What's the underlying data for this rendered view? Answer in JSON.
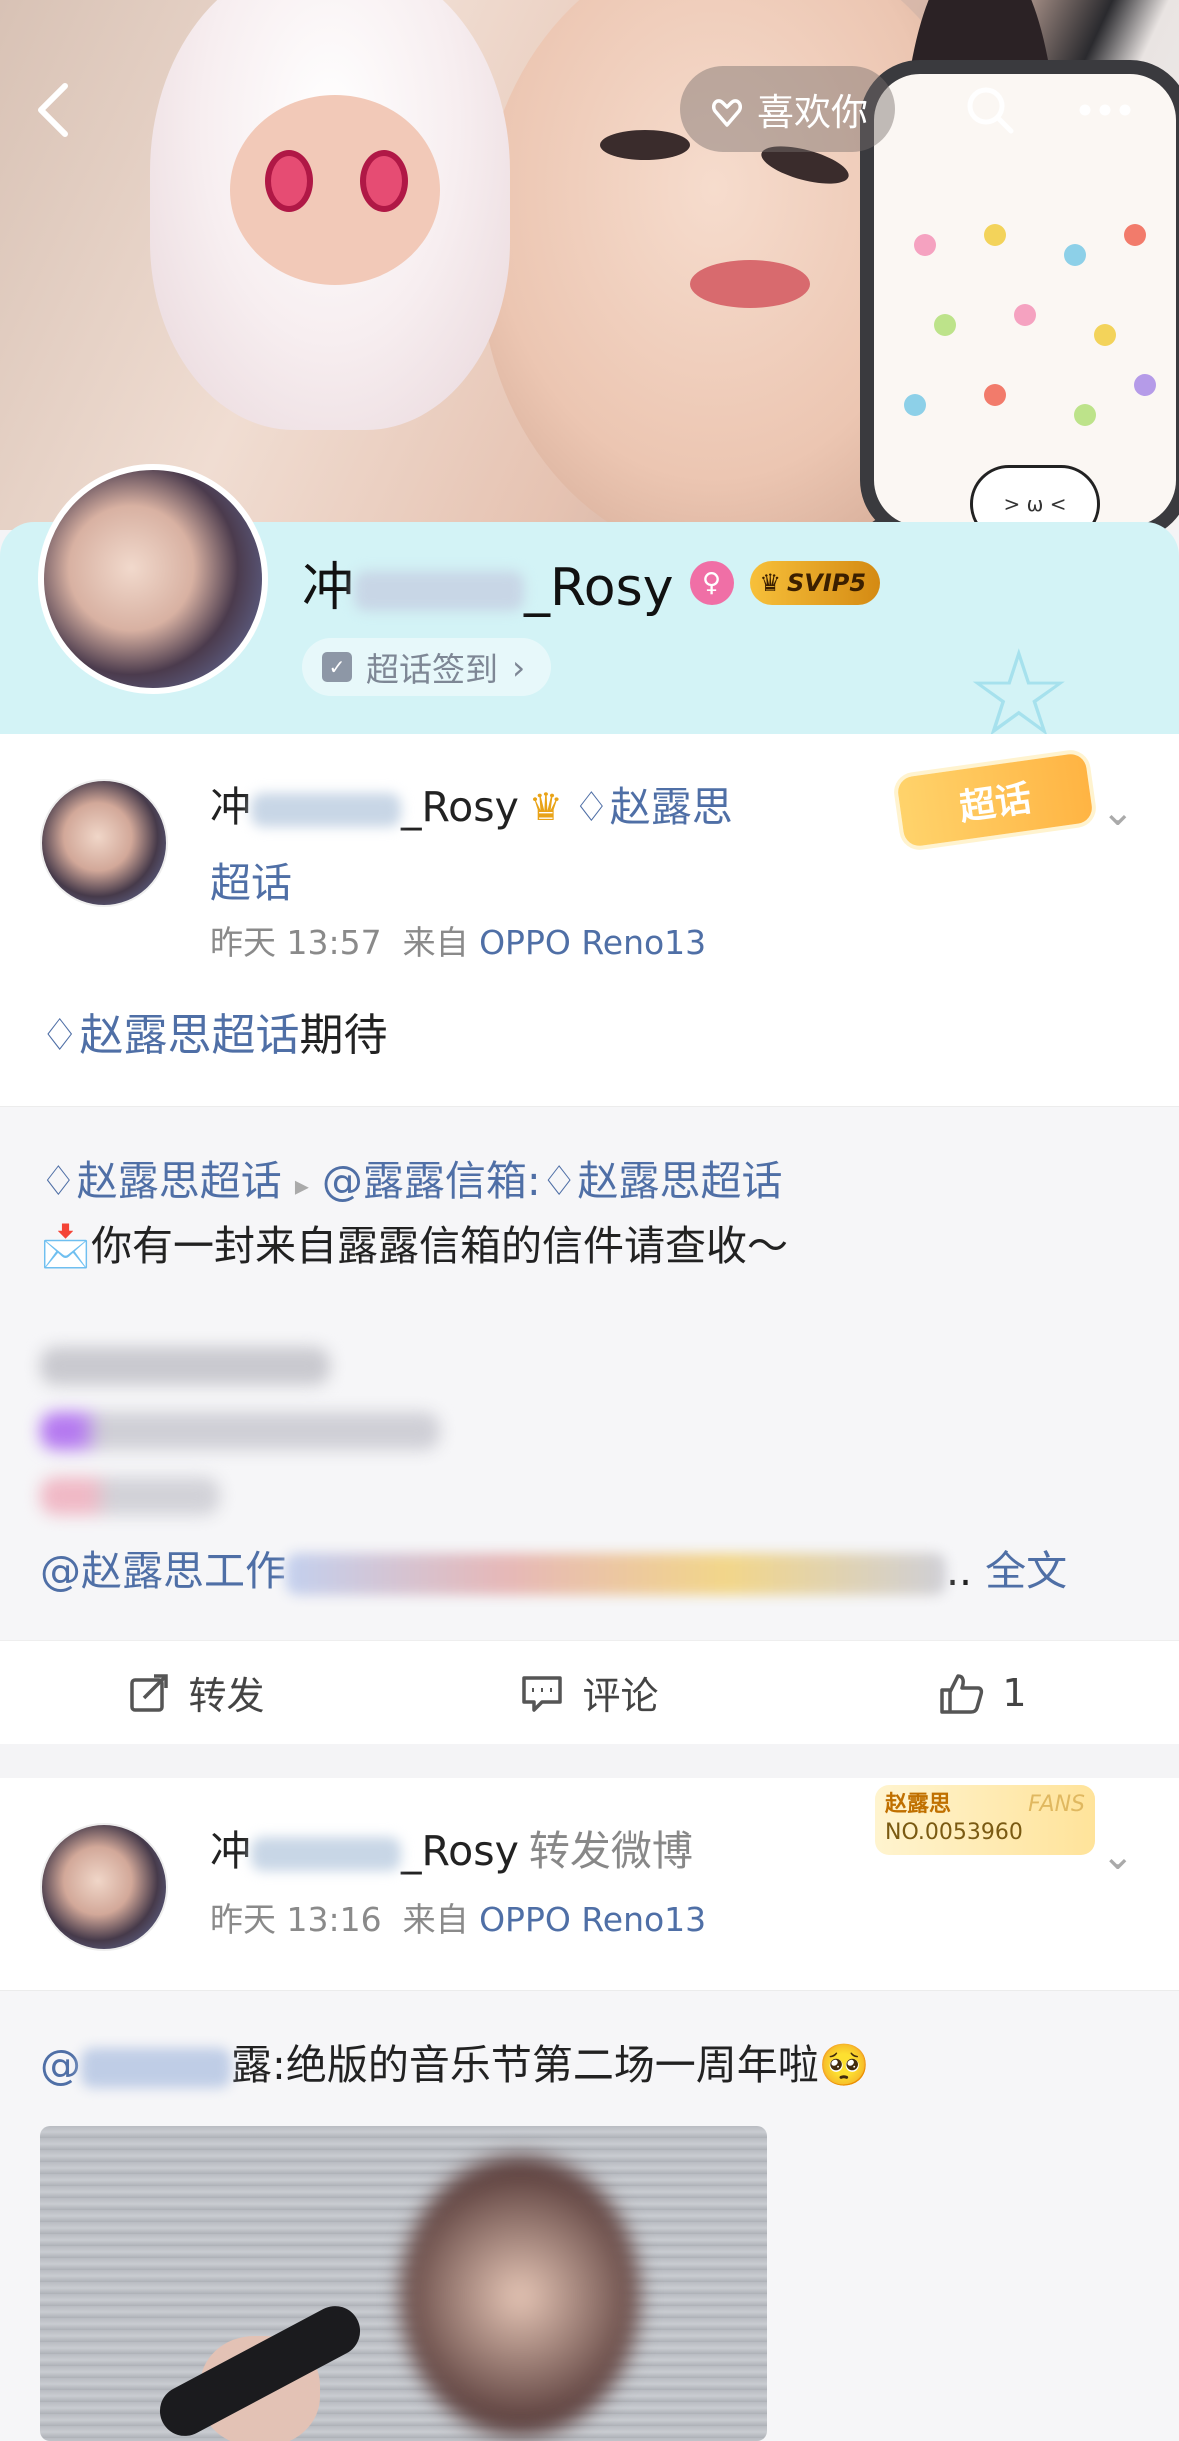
{
  "cover": {
    "back_icon": "chevron-left-icon",
    "like_label": "喜欢你",
    "like_icon": "hand-heart-icon",
    "search_icon": "search-icon",
    "more_icon": "more-dots-icon",
    "sticker_text": "> ω <"
  },
  "profile": {
    "name_prefix": "冲",
    "name_suffix": "_Rosy",
    "gender_icon": "female-icon",
    "svip_label": "SVIP5",
    "checkin_label": "超话签到",
    "checkin_arrow": "›",
    "band_color": "#d3f3f6"
  },
  "post1": {
    "author_prefix": "冲",
    "author_suffix": "_Rosy",
    "supertopic_inline": "赵露思",
    "supertopic_line2": "超话",
    "time": "昨天 13:57",
    "source_prefix": "来自",
    "device": "OPPO Reno13",
    "badge": "超话",
    "body_link": "赵露思超话",
    "body_text": "期待",
    "quote": {
      "line1_link1": "赵露思超话",
      "line1_sep": "▸",
      "line1_link2": "@露露信箱:",
      "line1_link3": "赵露思超话",
      "line2": "你有一封来自露露信箱的信件请查收～",
      "mention": "@赵露思工作",
      "more_dots": "..",
      "full_text": "全文"
    },
    "actions": {
      "repost": "转发",
      "comment": "评论",
      "like": "1"
    }
  },
  "post2": {
    "author_prefix": "冲",
    "author_suffix": "_Rosy",
    "action_text": "转发微博",
    "time": "昨天 13:16",
    "source_prefix": "来自",
    "device": "OPPO Reno13",
    "fans_name": "赵露思",
    "fans_no": "NO.0053960",
    "fans_tag": "FANS",
    "quote_at": "@",
    "quote_tail": "露:绝版的音乐节第二场一周年啦🥺"
  },
  "colors": {
    "link": "#4f6fa6",
    "meta": "#8a8a8a",
    "svip_gold": "#f7c03a"
  }
}
